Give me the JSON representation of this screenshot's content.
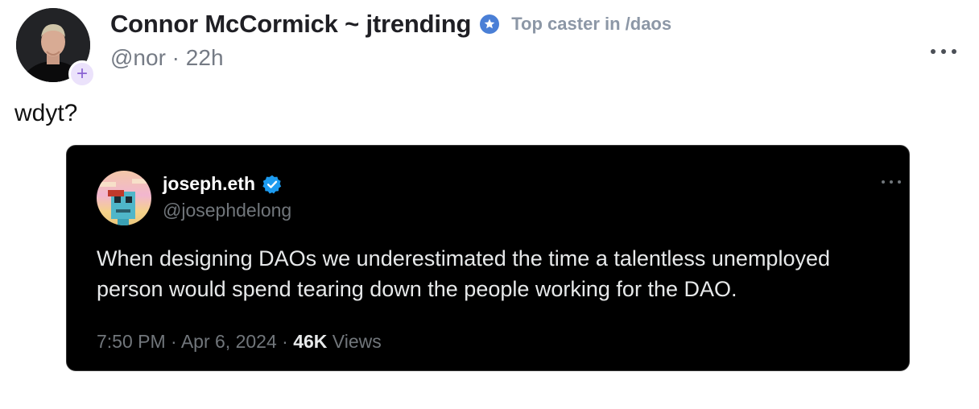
{
  "cast": {
    "author_name": "Connor McCormick ~ jtrending",
    "channel_note": "Top caster in /daos",
    "handle": "@nor",
    "separator": " · ",
    "time_ago": "22h",
    "text": "wdyt?"
  },
  "quote": {
    "author_name": "joseph.eth",
    "handle": "@josephdelong",
    "text": "When designing DAOs we underestimated the time a talentless unemployed person would spend tearing down the people working for the DAO.",
    "time": "7:50 PM",
    "separator": " · ",
    "date": "Apr 6, 2024",
    "views_count": "46K",
    "views_label": " Views"
  },
  "icons": {
    "follow": "plus-icon",
    "power_badge": "star-badge-icon",
    "verified": "verified-check-icon",
    "more": "more-horizontal-icon"
  },
  "colors": {
    "badge_blue": "#4a7fd6",
    "verified_blue": "#1d9bf0",
    "follow_purple": "#8a63d2",
    "quote_bg": "#000000"
  }
}
